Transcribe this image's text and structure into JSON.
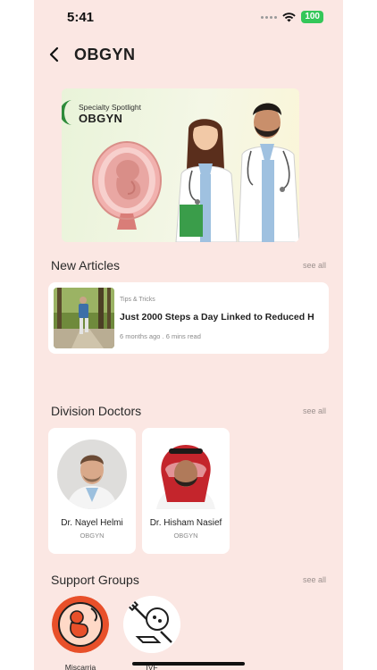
{
  "status_bar": {
    "time": "5:41",
    "battery": "100"
  },
  "header": {
    "title": "OBGYN"
  },
  "banner": {
    "kicker": "Specialty Spotlight",
    "title": "OBGYN"
  },
  "articles": {
    "section_title": "New Articles",
    "see_all": "see all",
    "items": [
      {
        "tag": "Tips & Tricks",
        "title": "Just 2000 Steps a Day Linked to Reduced H",
        "meta": "6 months ago . 6 mins read"
      }
    ]
  },
  "doctors": {
    "section_title": "Division Doctors",
    "see_all": "see all",
    "items": [
      {
        "name": "Dr. Nayel Helmi",
        "specialty": "OBGYN"
      },
      {
        "name": "Dr. Hisham Nasief",
        "specialty": "OBGYN"
      }
    ]
  },
  "support_groups": {
    "section_title": "Support Groups",
    "see_all": "see all",
    "items": [
      {
        "label": "Miscarria"
      },
      {
        "label": "IVF"
      }
    ]
  },
  "colors": {
    "background": "#fbe7e3",
    "card": "#ffffff",
    "banner_accent": "#2e8b3a",
    "miscarriage_accent": "#e8502a"
  }
}
